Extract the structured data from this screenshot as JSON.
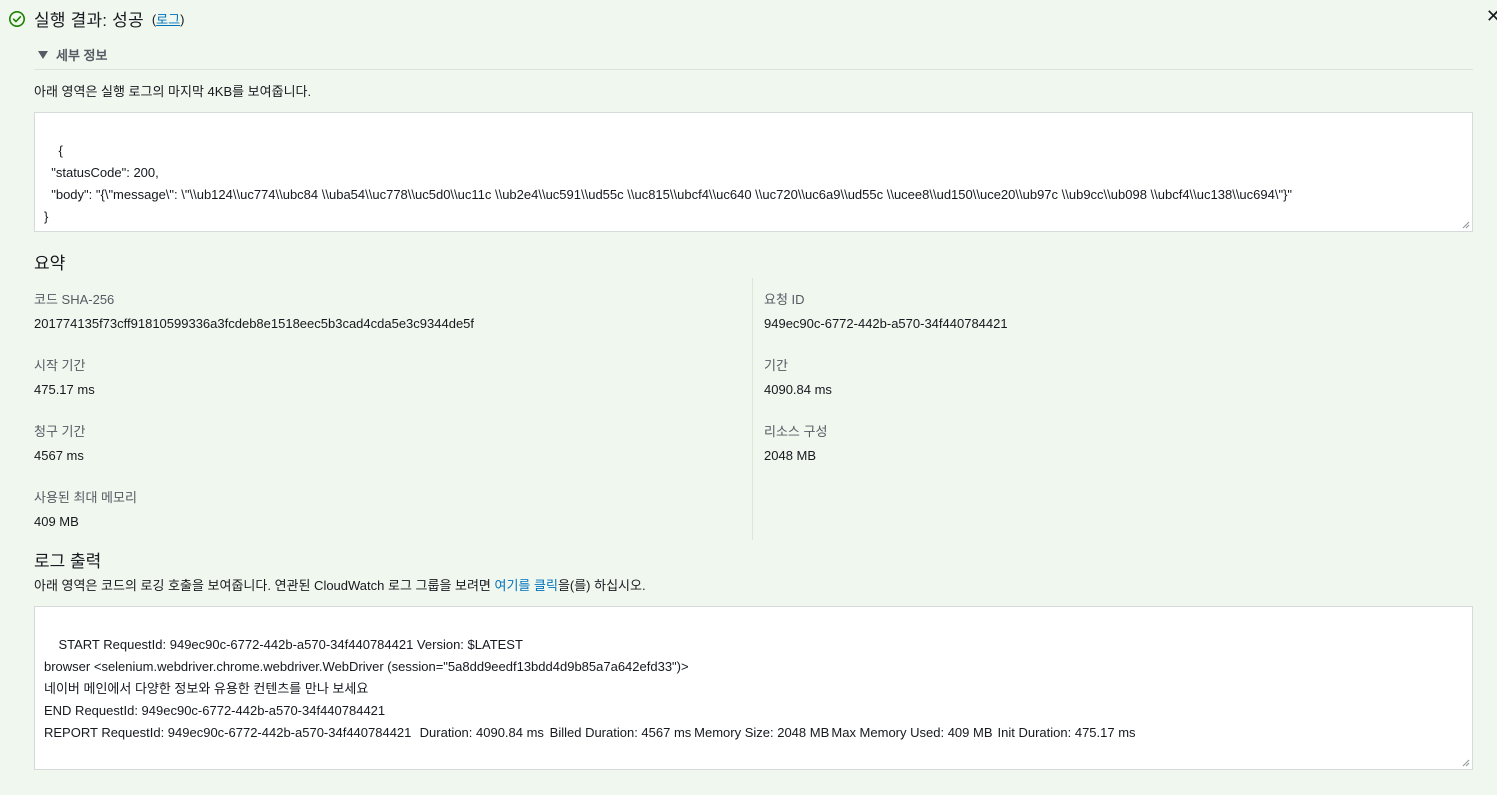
{
  "header": {
    "title": "실행 결과: 성공",
    "paren_open": "(",
    "log_link": "로그",
    "paren_close": ")"
  },
  "details": {
    "label": "세부 정보",
    "description": "아래 영역은 실행 로그의 마지막 4KB를 보여줍니다.",
    "output": "{\n  \"statusCode\": 200,\n  \"body\": \"{\\\"message\\\": \\\"\\\\ub124\\\\uc774\\\\ubc84 \\\\uba54\\\\uc778\\\\uc5d0\\\\uc11c \\\\ub2e4\\\\uc591\\\\ud55c \\\\uc815\\\\ubcf4\\\\uc640 \\\\uc720\\\\uc6a9\\\\ud55c \\\\ucee8\\\\ud150\\\\uce20\\\\ub97c \\\\ub9cc\\\\ub098 \\\\ubcf4\\\\uc138\\\\uc694\\\"}\"\n}"
  },
  "summary": {
    "title": "요약",
    "left": [
      {
        "label": "코드 SHA-256",
        "value": "201774135f73cff91810599336a3fcdeb8e1518eec5b3cad4cda5e3c9344de5f"
      },
      {
        "label": "시작 기간",
        "value": "475.17 ms"
      },
      {
        "label": "청구 기간",
        "value": "4567 ms"
      },
      {
        "label": "사용된 최대 메모리",
        "value": "409 MB"
      }
    ],
    "right": [
      {
        "label": "요청 ID",
        "value": "949ec90c-6772-442b-a570-34f440784421"
      },
      {
        "label": "기간",
        "value": "4090.84 ms"
      },
      {
        "label": "리소스 구성",
        "value": "2048 MB"
      }
    ]
  },
  "log_output": {
    "title": "로그 출력",
    "desc_prefix": "아래 영역은 코드의 로깅 호출을 보여줍니다. 연관된 CloudWatch 로그 그룹을 보려면 ",
    "desc_link": "여기를 클릭",
    "desc_suffix": "을(를) 하십시오.",
    "content": "START RequestId: 949ec90c-6772-442b-a570-34f440784421 Version: $LATEST\nbrowser <selenium.webdriver.chrome.webdriver.WebDriver (session=\"5a8dd9eedf13bdd4d9b85a7a642efd33\")>\n네이버 메인에서 다양한 정보와 유용한 컨텐츠를 만나 보세요\nEND RequestId: 949ec90c-6772-442b-a570-34f440784421\nREPORT RequestId: 949ec90c-6772-442b-a570-34f440784421\tDuration: 4090.84 ms\tBilled Duration: 4567 ms\tMemory Size: 2048 MB\tMax Memory Used: 409 MB\tInit Duration: 475.17 ms"
  },
  "colors": {
    "success": "#1d8102",
    "link": "#0073bb",
    "background": "#f0f7ee"
  },
  "icons": {
    "status": "check-circle-icon",
    "close": "close-icon",
    "toggle": "caret-down-icon"
  }
}
